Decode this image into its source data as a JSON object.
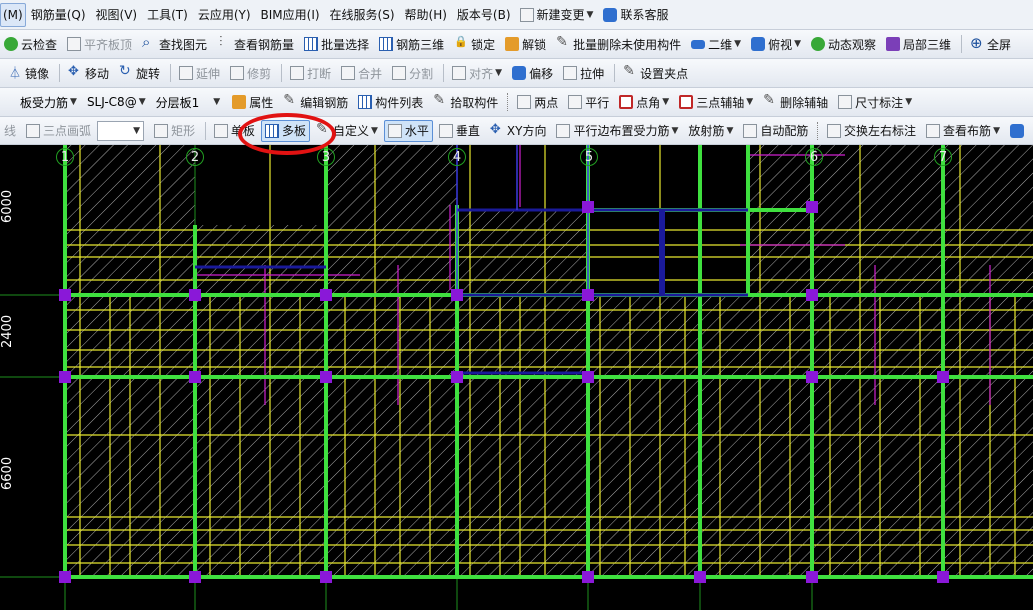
{
  "menu": {
    "items": [
      "(M)",
      "钢筋量(Q)",
      "视图(V)",
      "工具(T)",
      "云应用(Y)",
      "BIM应用(I)",
      "在线服务(S)",
      "帮助(H)",
      "版本号(B)"
    ],
    "new_change": "新建变更",
    "support": "联系客服"
  },
  "toolbar1": {
    "items": [
      "云检查",
      "平齐板顶",
      "查找图元",
      "查看钢筋量",
      "批量选择",
      "钢筋三维",
      "锁定",
      "解锁",
      "批量删除未使用构件",
      "二维",
      "俯视",
      "动态观察",
      "局部三维",
      "全屏"
    ]
  },
  "toolbar2": {
    "items": [
      "镜像",
      "移动",
      "旋转",
      "延伸",
      "修剪",
      "打断",
      "合并",
      "分割",
      "对齐",
      "偏移",
      "拉伸",
      "设置夹点"
    ]
  },
  "toolbar3": {
    "combo_type": "板受力筋",
    "combo_name": "SLJ-C8@",
    "combo_layer": "分层板1",
    "attr": "属性",
    "items": [
      "编辑钢筋",
      "构件列表",
      "拾取构件",
      "两点",
      "平行",
      "点角",
      "三点辅轴",
      "删除辅轴",
      "尺寸标注"
    ]
  },
  "toolbar4": {
    "line": "线",
    "arc": "三点画弧",
    "rect": "矩形",
    "single": "单板",
    "multi": "多板",
    "custom": "自定义",
    "horizontal": "水平",
    "vertical": "垂直",
    "xy": "XY方向",
    "parallel_edge": "平行边布置受力筋",
    "radial": "放射筋",
    "auto": "自动配筋",
    "swap": "交换左右标注",
    "view": "查看布筋"
  },
  "canvas": {
    "dims": [
      "6000",
      "2400",
      "6600"
    ],
    "axis_labels": [
      "1",
      "2",
      "3",
      "4",
      "5",
      "6",
      "7"
    ]
  }
}
